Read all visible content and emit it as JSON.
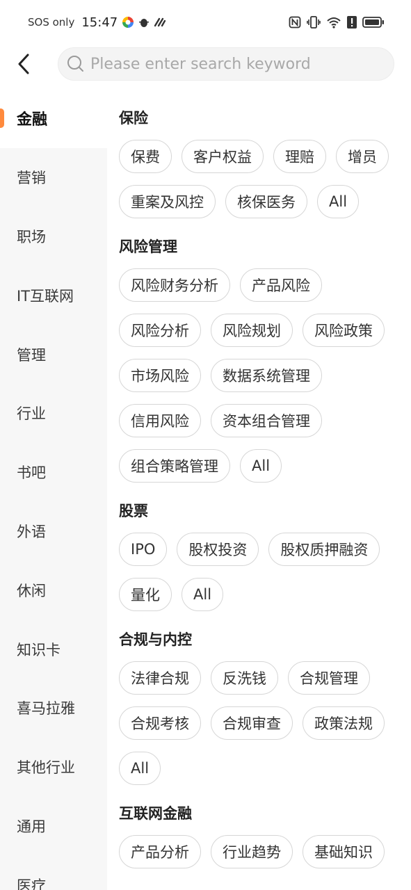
{
  "status_bar": {
    "carrier": "SOS only",
    "time": "15:47"
  },
  "search": {
    "placeholder": "Please enter search keyword"
  },
  "sidebar": {
    "items": [
      {
        "label": "金融",
        "active": true
      },
      {
        "label": "营销"
      },
      {
        "label": "职场"
      },
      {
        "label": "IT互联网"
      },
      {
        "label": "管理"
      },
      {
        "label": "行业"
      },
      {
        "label": "书吧"
      },
      {
        "label": "外语"
      },
      {
        "label": "休闲"
      },
      {
        "label": "知识卡"
      },
      {
        "label": "喜马拉雅"
      },
      {
        "label": "其他行业"
      },
      {
        "label": "通用"
      },
      {
        "label": "医疗"
      }
    ]
  },
  "sections": [
    {
      "title": "保险",
      "tags": [
        "保费",
        "客户权益",
        "理赔",
        "增员",
        "重案及风控",
        "核保医务",
        "All"
      ]
    },
    {
      "title": "风险管理",
      "tags": [
        "风险财务分析",
        "产品风险",
        "风险分析",
        "风险规划",
        "风险政策",
        "市场风险",
        "数据系统管理",
        "信用风险",
        "资本组合管理",
        "组合策略管理",
        "All"
      ]
    },
    {
      "title": "股票",
      "tags": [
        "IPO",
        "股权投资",
        "股权质押融资",
        "量化",
        "All"
      ]
    },
    {
      "title": "合规与内控",
      "tags": [
        "法律合规",
        "反洗钱",
        "合规管理",
        "合规考核",
        "合规审查",
        "政策法规",
        "All"
      ]
    },
    {
      "title": "互联网金融",
      "tags": [
        "产品分析",
        "行业趋势",
        "基础知识"
      ]
    }
  ],
  "colors": {
    "accent": "#ff8a3d",
    "sidebar_bg": "#f7f7f7",
    "tag_border": "#d6d6d6"
  }
}
